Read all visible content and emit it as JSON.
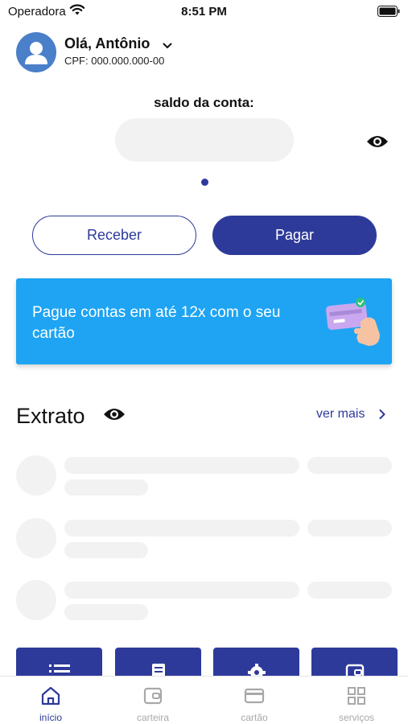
{
  "status_bar": {
    "carrier": "Operadora",
    "time": "8:51 PM"
  },
  "header": {
    "greeting": "Olá, Antônio",
    "cpf": "CPF: 000.000.000-00"
  },
  "balance": {
    "label": "saldo da conta:"
  },
  "actions": {
    "receive": "Receber",
    "pay": "Pagar"
  },
  "promo": {
    "text": "Pague contas em até 12x com o seu cartão"
  },
  "extrato": {
    "title": "Extrato",
    "see_more": "ver mais"
  },
  "nav": {
    "items": [
      {
        "label": "início",
        "icon": "home-icon",
        "active": true
      },
      {
        "label": "carteira",
        "icon": "wallet-icon",
        "active": false
      },
      {
        "label": "cartão",
        "icon": "card-icon",
        "active": false
      },
      {
        "label": "serviços",
        "icon": "grid-icon",
        "active": false
      }
    ]
  },
  "colors": {
    "primary": "#2e3a9a",
    "promo_bg": "#1ea4f3",
    "skeleton": "#f2f2f2",
    "inactive": "#a8a8a8"
  }
}
